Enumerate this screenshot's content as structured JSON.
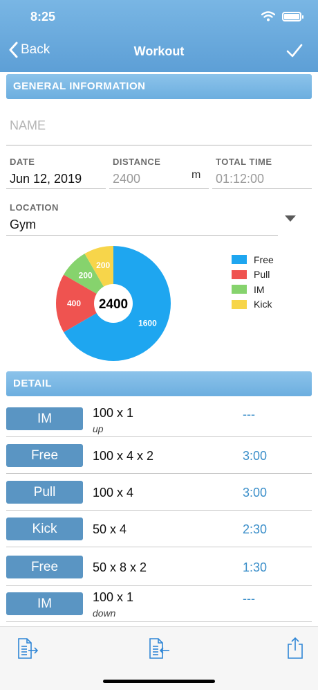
{
  "status": {
    "time": "8:25"
  },
  "nav": {
    "back_label": "Back",
    "title": "Workout"
  },
  "general": {
    "header": "GENERAL INFORMATION",
    "name_placeholder": "NAME",
    "date_label": "DATE",
    "date_value": "Jun 12, 2019",
    "distance_label": "DISTANCE",
    "distance_value": "2400",
    "distance_unit": "m",
    "total_time_label": "TOTAL TIME",
    "total_time_value": "01:12:00",
    "location_label": "LOCATION",
    "location_value": "Gym"
  },
  "chart_data": {
    "type": "pie",
    "center_label": "2400",
    "categories": [
      "Free",
      "Pull",
      "IM",
      "Kick"
    ],
    "values": [
      1600,
      400,
      200,
      200
    ],
    "colors": [
      "#1ea6f0",
      "#ef5350",
      "#86d36d",
      "#f7d54a"
    ],
    "legend_placement": "right"
  },
  "detail": {
    "header": "DETAIL",
    "rows": [
      {
        "stroke": "IM",
        "set": "100 x 1",
        "note": "up",
        "interval": "---"
      },
      {
        "stroke": "Free",
        "set": "100 x 4 x 2",
        "note": "",
        "interval": "3:00"
      },
      {
        "stroke": "Pull",
        "set": "100 x 4",
        "note": "",
        "interval": "3:00"
      },
      {
        "stroke": "Kick",
        "set": "50 x 4",
        "note": "",
        "interval": "2:30"
      },
      {
        "stroke": "Free",
        "set": "50 x 8 x 2",
        "note": "",
        "interval": "1:30"
      },
      {
        "stroke": "IM",
        "set": "100 x 1",
        "note": "down",
        "interval": "---"
      }
    ]
  },
  "icons": {
    "back": "chevron-left-icon",
    "done": "checkmark-icon",
    "export": "document-export-icon",
    "import": "document-import-icon",
    "share": "share-icon"
  },
  "colors": {
    "header": "#6aa8dc",
    "section": "#7db9e6",
    "stroke_button": "#5a95c3",
    "interval_text": "#3a8ec9",
    "toolbar_icon": "#2f86d6"
  }
}
